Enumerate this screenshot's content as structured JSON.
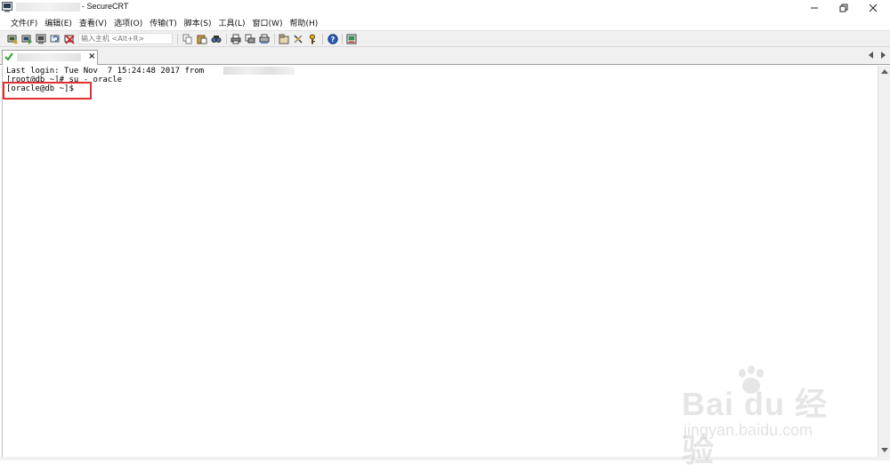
{
  "window": {
    "title": "- SecureCRT"
  },
  "menu": [
    "文件(F)",
    "编辑(E)",
    "查看(V)",
    "选项(O)",
    "传输(T)",
    "脚本(S)",
    "工具(L)",
    "窗口(W)",
    "帮助(H)"
  ],
  "toolbar": {
    "host_placeholder": "输入主机 <Alt+R>"
  },
  "tab": {
    "close_glyph": "×"
  },
  "terminal": {
    "lines": [
      "Last login: Tue Nov  7 15:24:48 2017 from",
      "[root@db ~]# su - oracle",
      "[oracle@db ~]$"
    ]
  },
  "watermark": {
    "brand": "Bai du 经验",
    "site": "jingyan.baidu.com"
  },
  "colors": {
    "highlight": "#e03030",
    "toolbar_bg": "#f0f0f0"
  }
}
